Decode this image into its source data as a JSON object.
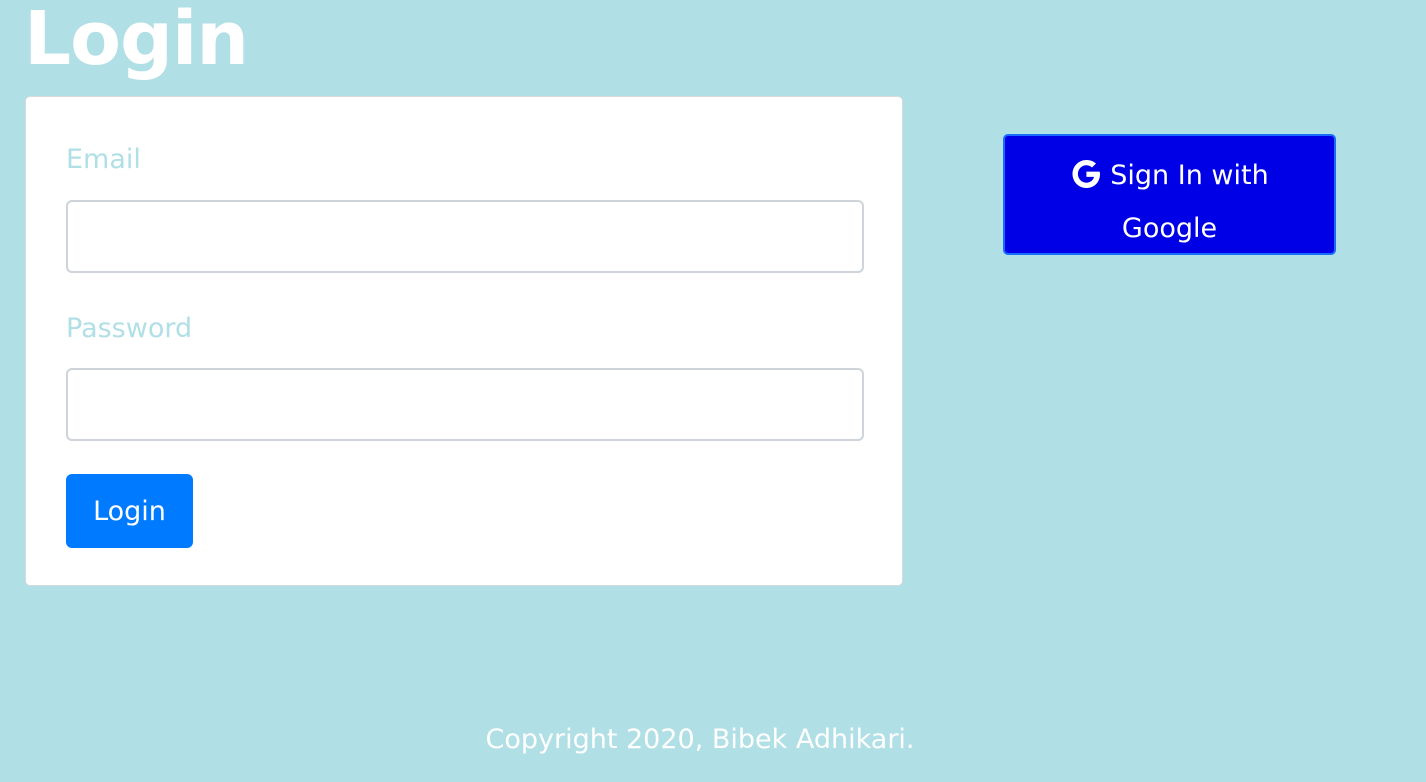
{
  "header": {
    "title": "Login"
  },
  "login_form": {
    "email_label": "Email",
    "email_value": "",
    "password_label": "Password",
    "password_value": "",
    "submit_label": "Login"
  },
  "google_signin": {
    "label": "Sign In with Google",
    "icon": "google-g-icon"
  },
  "footer": {
    "copyright": "Copyright 2020, Bibek Adhikari."
  },
  "colors": {
    "background": "#b0dfe5",
    "primary_button": "#007bff",
    "google_button": "#0000e6",
    "label_text": "#b0dfe5"
  }
}
